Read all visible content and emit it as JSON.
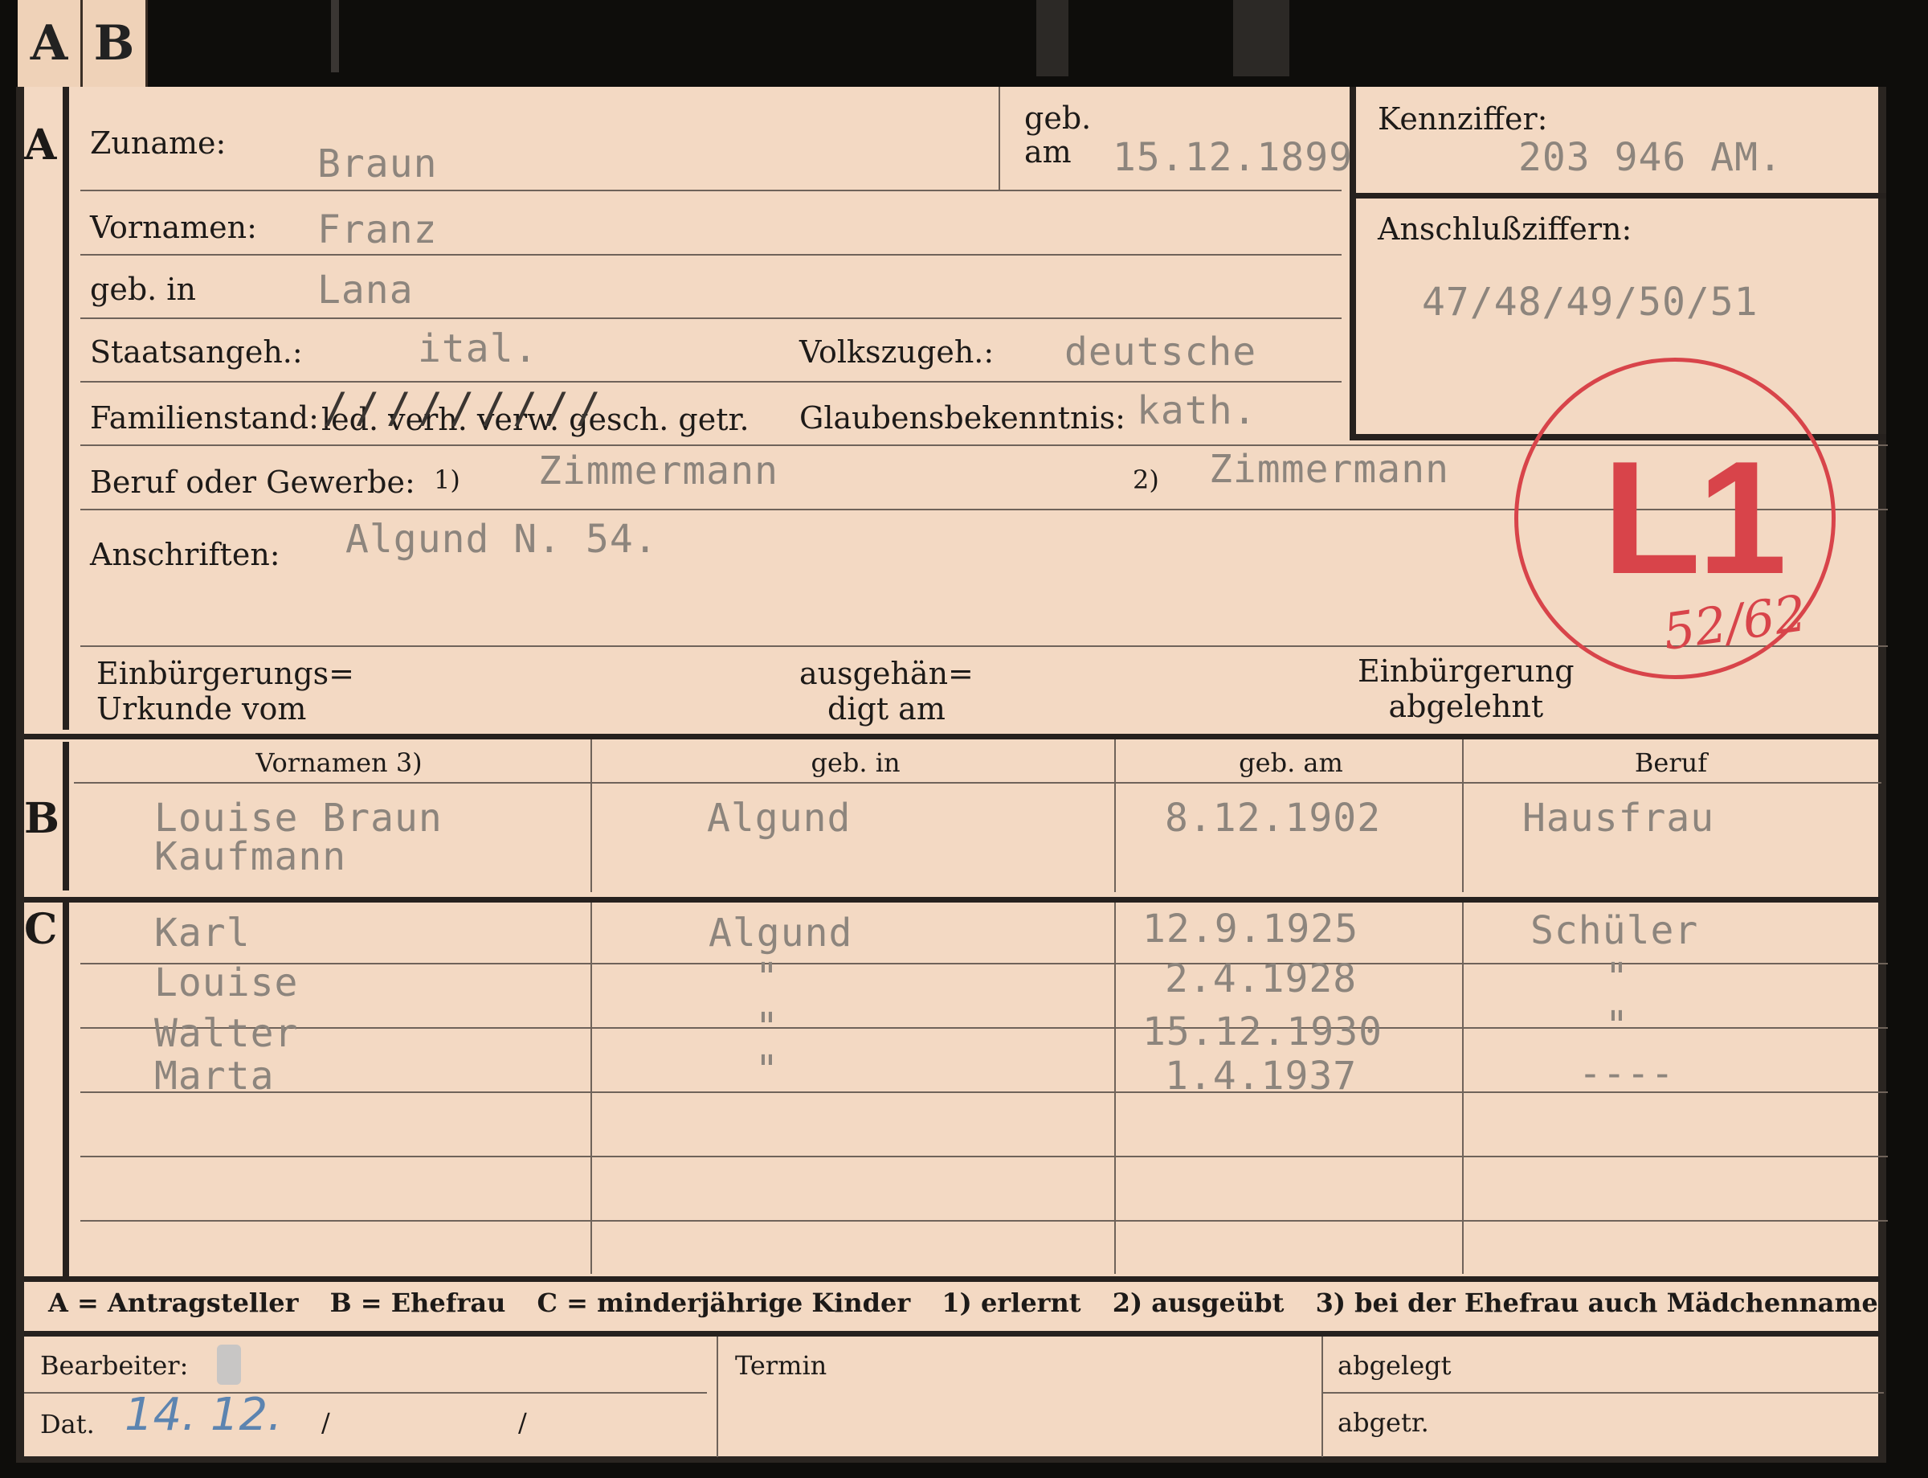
{
  "tabs": [
    "A",
    "B"
  ],
  "section_a": {
    "marker": "A",
    "zuname_label": "Zuname:",
    "zuname_value": "Braun",
    "geb_am_label_1": "geb.",
    "geb_am_label_2": "am",
    "geb_am_value": "15.12.1899",
    "kennziffer_label": "Kennziffer:",
    "kennziffer_value": "203 946 AM.",
    "vornamen_label": "Vornamen:",
    "vornamen_value": "Franz",
    "anschluss_label": "Anschlußziffern:",
    "anschluss_value": "47/48/49/50/51",
    "geb_in_label": "geb. in",
    "geb_in_value": "Lana",
    "staats_label": "Staatsangeh.:",
    "staats_value": "ital.",
    "volks_label": "Volkszugeh.:",
    "volks_value": "deutsche",
    "familien_label": "Familienstand:",
    "familien_options": "led. verh. verw. gesch. getr.",
    "familien_strike": "/////////",
    "glauben_label": "Glaubensbekenntnis:",
    "glauben_value": "kath.",
    "beruf_label": "Beruf oder Gewerbe:",
    "beruf_note1": "1)",
    "beruf_value1": "Zimmermann",
    "beruf_note2": "2)",
    "beruf_value2": "Zimmermann",
    "anschriften_label": "Anschriften:",
    "anschriften_value": "Algund N. 54.",
    "einb_urkunde_1": "Einbürgerungs=",
    "einb_urkunde_2": "Urkunde vom",
    "ausgeh_1": "ausgehän=",
    "ausgeh_2": "digt am",
    "einb_abgelehnt_1": "Einbürgerung",
    "einb_abgelehnt_2": "abgelehnt"
  },
  "stamp": {
    "code": "L1",
    "number": "52/62",
    "color": "#d8444a"
  },
  "columns": {
    "vornamen": "Vornamen 3)",
    "geb_in": "geb. in",
    "geb_am": "geb. am",
    "beruf": "Beruf"
  },
  "section_b": {
    "marker": "B",
    "name_line1": "Louise Braun",
    "name_line2": "Kaufmann",
    "geb_in": "Algund",
    "geb_am": "8.12.1902",
    "beruf": "Hausfrau"
  },
  "section_c": {
    "marker": "C",
    "rows": [
      {
        "name": "Karl",
        "geb_in": "Algund",
        "geb_am": "12.9.1925",
        "beruf": "Schüler"
      },
      {
        "name": "Louise",
        "geb_in": "\"",
        "geb_am": "2.4.1928",
        "beruf": "\""
      },
      {
        "name": "Walter",
        "geb_in": "\"",
        "geb_am": "15.12.1930",
        "beruf": "\""
      },
      {
        "name": "Marta",
        "geb_in": "\"",
        "geb_am": "1.4.1937",
        "beruf": "----"
      }
    ]
  },
  "legend": {
    "a": "A = Antragsteller",
    "b": "B = Ehefrau",
    "c": "C = minderjährige Kinder",
    "n1": "1) erlernt",
    "n2": "2) ausgeübt",
    "n3": "3) bei der Ehefrau auch Mädchenname"
  },
  "footer": {
    "bearbeiter_label": "Bearbeiter:",
    "dat_label": "Dat.",
    "dat_value": "14. 12.",
    "dat_sep1": "/",
    "dat_sep2": "/",
    "termin_label": "Termin",
    "abgelegt_label": "abgelegt",
    "abgetr_label": "abgetr."
  }
}
